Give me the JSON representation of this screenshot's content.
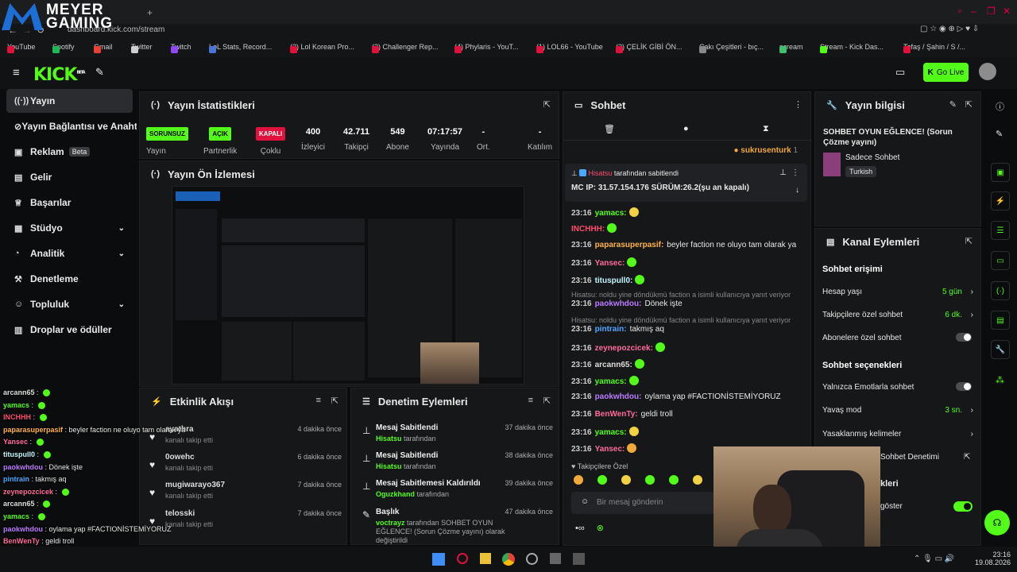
{
  "browser": {
    "url": "dashboard.kick.com/stream",
    "bookmarks": [
      "YouTube",
      "Spotify",
      "Gmail",
      "Twitter",
      "Twitch",
      "LoL Stats, Record...",
      "(2) Lol Korean Pro...",
      "(2) Challenger Rep...",
      "(4) Phylaris - YouT...",
      "(1) LOL66 - YouTube",
      "(2) ÇELİK GİBİ ÖN...",
      "Çakı Çeşitleri - bıç...",
      "scream",
      "Stream - Kick Das...",
      "Tofaş / Şahin / S /..."
    ]
  },
  "overlay_logo": {
    "line1": "MEYER",
    "line2": "GAMING"
  },
  "app": {
    "brand": "KICK",
    "brand_sup": "BETA",
    "go_live": "Go Live"
  },
  "sidebar": {
    "items": [
      {
        "label": "Yayın",
        "icon": "broadcast-icon"
      },
      {
        "label": "Yayın Bağlantısı ve Anahtarı",
        "icon": "link-icon"
      },
      {
        "label": "Reklam",
        "badge": "Beta",
        "icon": "ad-icon"
      },
      {
        "label": "Gelir",
        "icon": "money-icon"
      },
      {
        "label": "Başarılar",
        "icon": "trophy-icon"
      },
      {
        "label": "Stüdyo",
        "icon": "studio-icon"
      },
      {
        "label": "Analitik",
        "icon": "analytics-icon"
      },
      {
        "label": "Denetleme",
        "icon": "hammer-icon"
      },
      {
        "label": "Topluluk",
        "icon": "community-icon"
      },
      {
        "label": "Droplar ve ödüller",
        "icon": "gift-icon"
      }
    ]
  },
  "stats": {
    "title": "Yayın İstatistikleri",
    "items": [
      {
        "value": "SORUNSUZ",
        "label": "Yayın"
      },
      {
        "value": "AÇIK",
        "label": "Partnerlik"
      },
      {
        "value": "KAPALI",
        "label": "Çoklu"
      },
      {
        "value": "400",
        "label": "İzleyici"
      },
      {
        "value": "42.711",
        "label": "Takipçi"
      },
      {
        "value": "549",
        "label": "Abone"
      },
      {
        "value": "07:17:57",
        "label": "Yayında"
      },
      {
        "value": "-",
        "label": "Ort."
      },
      {
        "value": "-",
        "label": "Katılım"
      }
    ]
  },
  "preview": {
    "title": "Yayın Ön İzlemesi"
  },
  "activity": {
    "title": "Etkinlik Akışı",
    "items": [
      {
        "name": "ayathra",
        "sub": "kanalı takip etti",
        "time": "4 dakika önce"
      },
      {
        "name": "0owehc",
        "sub": "kanalı takip etti",
        "time": "6 dakika önce"
      },
      {
        "name": "mugiwarayo367",
        "sub": "kanalı takip etti",
        "time": "7 dakika önce"
      },
      {
        "name": "telosski",
        "sub": "kanalı takip etti",
        "time": "7 dakika önce"
      }
    ]
  },
  "moderation": {
    "title": "Denetim Eylemleri",
    "items": [
      {
        "name": "Mesaj Sabitlendi",
        "user": "Hisatsu",
        "sub": "tarafından",
        "time": "37 dakika önce"
      },
      {
        "name": "Mesaj Sabitlendi",
        "user": "Hisatsu",
        "sub": "tarafından",
        "time": "38 dakika önce"
      },
      {
        "name": "Mesaj Sabitlemesi Kaldırıldı",
        "user": "Oguzkhand",
        "sub": "tarafından",
        "time": "39 dakika önce"
      },
      {
        "name": "Başlık",
        "user": "voctrayz",
        "sub": "tarafından SOHBET OYUN EĞLENCE! (Sorun Çözme yayını) olarak değiştirildi",
        "time": "47 dakika önce"
      }
    ]
  },
  "chat": {
    "title": "Sohbet",
    "top_user": "sukrusenturk",
    "top_count": "1",
    "pinned": {
      "by_user": "Hisatsu",
      "by_text": "tarafından sabitlendi",
      "message": "MC IP: 31.57.154.176 SÜRÜM:26.2(şu an kapalı)"
    },
    "messages": [
      {
        "ts": "23:16",
        "user": "yamacs:",
        "text": "",
        "color": "#53fc18"
      },
      {
        "ts": "",
        "user": "INCHHH:",
        "text": "",
        "color": "#ff4b6e"
      },
      {
        "ts": "23:16",
        "user": "paparasuperpasif:",
        "text": "beyler faction ne oluyo tam olarak ya",
        "color": "#ffb347"
      },
      {
        "ts": "23:16",
        "user": "Yansec:",
        "text": "",
        "color": "#ff6b9a"
      },
      {
        "ts": "23:16",
        "user": "tituspull0:",
        "text": "",
        "color": "#c2f6ff"
      },
      {
        "ts": "23:16",
        "user": "paokwhdou:",
        "text": "Dönek işte",
        "color": "#bb7bff"
      },
      {
        "ts": "23:16",
        "user": "pintrain:",
        "text": "takmış aq",
        "color": "#4aa8ff"
      },
      {
        "ts": "23:16",
        "user": "zeynepozcicek:",
        "text": "",
        "color": "#ff6b9a"
      },
      {
        "ts": "23:16",
        "user": "arcann65:",
        "text": "",
        "color": "#ddd"
      },
      {
        "ts": "23:16",
        "user": "yamacs:",
        "text": "",
        "color": "#53fc18"
      },
      {
        "ts": "23:16",
        "user": "paokwhdou:",
        "text": "oylama yap #FACTIONİSTEMİYORUZ",
        "color": "#bb7bff"
      },
      {
        "ts": "23:16",
        "user": "BenWenTy:",
        "text": "geldi troll",
        "color": "#ff6b9a"
      },
      {
        "ts": "23:16",
        "user": "yamacs:",
        "text": "",
        "color": "#53fc18"
      },
      {
        "ts": "23:16",
        "user": "Yansec:",
        "text": "",
        "color": "#ff6b9a"
      }
    ],
    "replies": [
      "Hisatsu: noldu yine döndükmü faction a isimli kullanıcıya yanıt veriyor",
      "Hisatsu: noldu yine döndükmü faction a isimli kullanıcıya yanıt veriyor"
    ],
    "followers_only": "Takipçilere Özel",
    "input_placeholder": "Bir mesaj gönderin"
  },
  "stream_info": {
    "title": "Yayın bilgisi",
    "stream_title": "SOHBET OYUN EĞLENCE! (Sorun Çözme yayını)",
    "category": "Sadece Sohbet",
    "language": "Turkish"
  },
  "channel_actions": {
    "title": "Kanal Eylemleri",
    "chat_access": "Sohbet erişimi",
    "account_age": "Hesap yaşı",
    "account_age_val": "5 gün",
    "follower_chat": "Takipçilere özel sohbet",
    "follower_chat_val": "6 dk.",
    "sub_chat": "Abonelere özel sohbet",
    "chat_options": "Sohbet seçenekleri",
    "emote_only": "Yalnızca Emotlarla sohbet",
    "slow_mode": "Yavaş mod",
    "slow_mode_val": "3 sn.",
    "banned_words": "Yasaklanmış kelimeler",
    "chat_mod": "Sohbet Denetimi",
    "partial_title": "kleri",
    "partial_show": "göster"
  },
  "overlay_chat": [
    {
      "user": "arcann65",
      "text": "",
      "color": "#ddd"
    },
    {
      "user": "yamacs",
      "text": "",
      "color": "#53fc18"
    },
    {
      "user": "INCHHH",
      "text": "",
      "color": "#ff4b6e"
    },
    {
      "user": "paparasuperpasif",
      "text": "beyler faction ne oluyo tam olarak ya",
      "color": "#ffb347"
    },
    {
      "user": "Yansec",
      "text": "",
      "color": "#ff6b9a"
    },
    {
      "user": "tituspull0",
      "text": "",
      "color": "#c2f6ff"
    },
    {
      "user": "paokwhdou",
      "text": "Dönek işte",
      "color": "#bb7bff"
    },
    {
      "user": "pintrain",
      "text": "takmış aq",
      "color": "#4aa8ff"
    },
    {
      "user": "zeynepozcicek",
      "text": "",
      "color": "#ff6b9a"
    },
    {
      "user": "arcann65",
      "text": "",
      "color": "#ddd"
    },
    {
      "user": "yamacs",
      "text": "",
      "color": "#53fc18"
    },
    {
      "user": "paokwhdou",
      "text": "oylama yap #FACTIONİSTEMİYORUZ",
      "color": "#bb7bff"
    },
    {
      "user": "BenWenTy",
      "text": "geldi troll",
      "color": "#ff6b9a"
    },
    {
      "user": "yamacs",
      "text": "",
      "color": "#53fc18"
    },
    {
      "user": "Yansec",
      "text": "",
      "color": "#ff6b9a"
    }
  ],
  "taskbar": {
    "time": "23:16",
    "date": "19.08.2026"
  },
  "colors": {
    "accent": "#53fc18",
    "panel": "#161718",
    "bg": "#0b0c0d"
  }
}
